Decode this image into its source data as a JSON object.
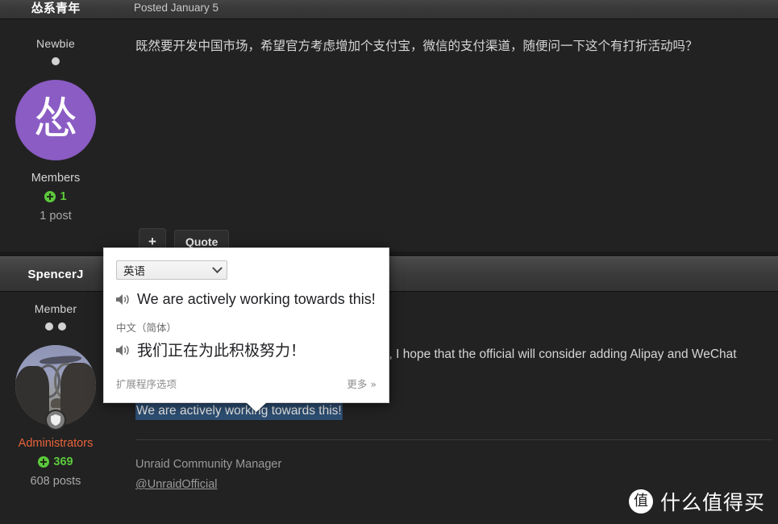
{
  "posts": [
    {
      "username": "怂系青年",
      "posted": "Posted January 5",
      "rank_title": "Newbie",
      "pip_count": 1,
      "avatar_type": "letter",
      "avatar_letter": "怂",
      "avatar_color": "#8b5cc4",
      "group": "Members",
      "group_color": "#d4d4d4",
      "reputation": "1",
      "post_count": "1 post",
      "body_text": "既然要开发中国市场，希望官方考虑增加个支付宝，微信的支付渠道，随便问一下这个有打折活动吗？",
      "actions": {
        "plus_label": "+",
        "quote_label": "Quote"
      }
    },
    {
      "username": "SpencerJ",
      "posted": "",
      "rank_title": "Member",
      "pip_count": 2,
      "avatar_type": "photo",
      "group": "Administrators",
      "group_color": "#e8633a",
      "reputation": "369",
      "post_count": "608 posts",
      "body_text": "Since we want to develop the Chinese market, I hope that the official will consider adding Alipay and WeChat",
      "highlighted_text": "We are actively working towards this!",
      "signature_line": "Unraid Community Manager",
      "signature_handle": "@UnraidOfficial"
    }
  ],
  "translate_popup": {
    "source_language": "英语",
    "source_text": "We are actively working towards this!",
    "target_language_label": "中文（简体）",
    "target_text": "我们正在为此积极努力！",
    "extension_options_label": "扩展程序选项",
    "more_label": "更多 »",
    "speaker_icon": "speaker-icon",
    "chevron_icon": "chevron-down-icon"
  },
  "watermark": {
    "logo_char": "值",
    "text": "什么值得买"
  },
  "colors": {
    "page_bg": "#222222",
    "header_bar": "#3a3a3a",
    "selection_blue": "#2d4e72",
    "reputation_green": "#5cc93c",
    "admin_orange": "#e8633a",
    "avatar_purple": "#8b5cc4",
    "popup_bg": "#ffffff"
  }
}
